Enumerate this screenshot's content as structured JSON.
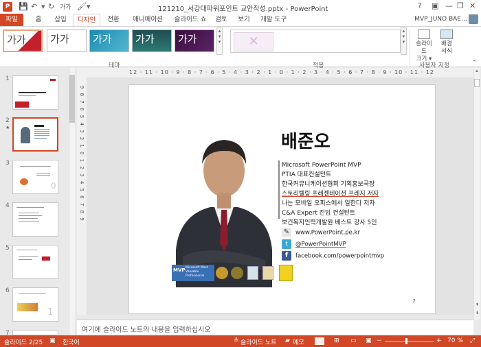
{
  "window": {
    "title": "121210_서강대파워포인트 교안작성.pptx - PowerPoint",
    "help": "?",
    "minimize": "—",
    "restore": "❐",
    "close": "✕"
  },
  "quick_access": {
    "font_size": "가가"
  },
  "tabs": [
    {
      "label": "파일"
    },
    {
      "label": "홈"
    },
    {
      "label": "삽입"
    },
    {
      "label": "디자인"
    },
    {
      "label": "전환"
    },
    {
      "label": "애니메이션"
    },
    {
      "label": "슬라이드 쇼"
    },
    {
      "label": "검토"
    },
    {
      "label": "보기"
    },
    {
      "label": "개발 도구"
    }
  ],
  "user": "MVP_JUNO BAE…",
  "ribbon": {
    "themes": [
      {
        "label": "가가"
      },
      {
        "label": "가가"
      },
      {
        "label": "가가"
      },
      {
        "label": "가가"
      },
      {
        "label": "가가"
      }
    ],
    "group_theme": "테마",
    "group_variant": "적용",
    "group_customize": "사용자 지정",
    "slide_size": "슬라이드\n크기",
    "slide_size_arrow": "▾",
    "format_bg": "배경\n서식"
  },
  "slides_panel": [
    {
      "num": "1"
    },
    {
      "num": "2",
      "star": "★"
    },
    {
      "num": "3"
    },
    {
      "num": "4"
    },
    {
      "num": "5"
    },
    {
      "num": "6"
    },
    {
      "num": "7"
    }
  ],
  "rulers": {
    "h": "12 · 11 · 10 · 9 · 8 · 7 · 6 · 5 · 4 · 3 · 2 · 1 · 0 · 1 · 2 · 3 · 4 · 5 · 6 · 7 · 8 · 9 · 10 · 11 · 12",
    "v": "9 8 7 6 5 4 3 2 1 0 1 2 3 4 5 6 7 8 9"
  },
  "slide": {
    "name": "배준오",
    "bio": [
      "Microsoft PowerPoint MVP",
      "PTIA 대표컨설턴트",
      "한국커뮤니케이션협회 기획홍보국장",
      "스토리텔링 프레젠테이션 프레지 저자",
      "나는 모바일 오피스에서 일한다 저자",
      "C&A Expert 전임 컨설턴트",
      "보건복지인력개발원 베스트 강사 5인"
    ],
    "contacts": [
      {
        "label": "www.PowerPoint.pe.kr",
        "icon": "pencil-icon"
      },
      {
        "label": "@PowerPointMVP",
        "icon": "twitter-icon"
      },
      {
        "label": "facebook.com/powerpointmvp",
        "icon": "facebook-icon"
      }
    ],
    "mvp_badge": "Microsoft Most Valuable Professional",
    "page_number": "2"
  },
  "notes_placeholder": "여기에 슬라이드 노트의 내용을 입력하십시오",
  "status": {
    "slide": "슬라이드 2/25",
    "language": "한국어",
    "notes": "슬라이드 노트",
    "comments": "메모",
    "zoom": "70 %",
    "minus": "−",
    "plus": "+"
  },
  "colors": {
    "accent": "#d24726"
  }
}
